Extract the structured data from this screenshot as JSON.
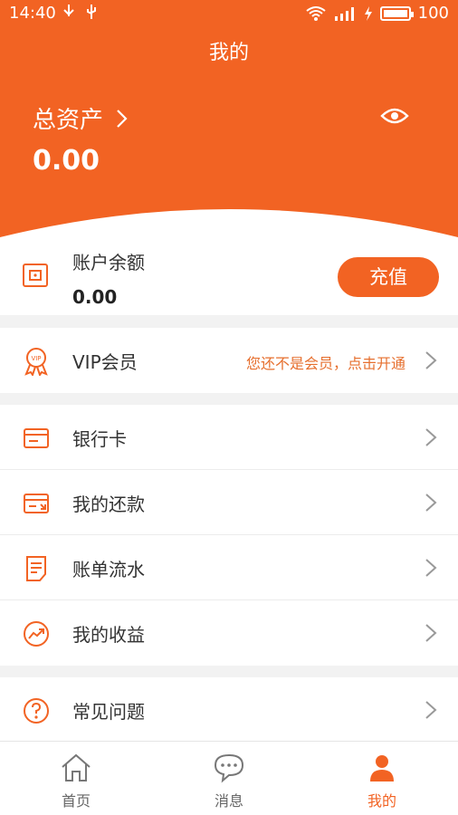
{
  "status_bar": {
    "time": "14:40",
    "battery": "100",
    "battery_level": 1.0
  },
  "header": {
    "title": "我的",
    "assets_label": "总资产",
    "assets_value": "0.00"
  },
  "balance": {
    "label": "账户余额",
    "value": "0.00",
    "recharge_label": "充值"
  },
  "vip": {
    "label": "VIP会员",
    "hint": "您还不是会员，点击开通"
  },
  "menu": {
    "items": [
      {
        "label": "银行卡",
        "icon": "bank-card-icon"
      },
      {
        "label": "我的还款",
        "icon": "repayment-icon"
      },
      {
        "label": "账单流水",
        "icon": "bill-icon"
      },
      {
        "label": "我的收益",
        "icon": "earnings-icon"
      }
    ]
  },
  "faq": {
    "label": "常见问题"
  },
  "tabs": [
    {
      "label": "首页",
      "icon": "home-icon"
    },
    {
      "label": "消息",
      "icon": "message-icon"
    },
    {
      "label": "我的",
      "icon": "profile-icon",
      "active": true
    }
  ],
  "colors": {
    "accent": "#f26323",
    "hint": "#e66f2e",
    "background": "#f2f2f2"
  }
}
